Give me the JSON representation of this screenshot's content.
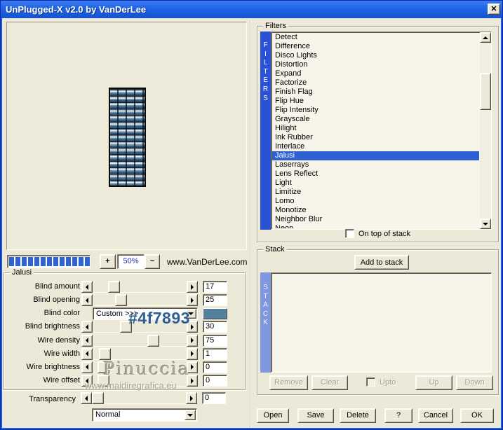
{
  "window": {
    "title": "UnPlugged-X v2.0 by VanDerLee",
    "close_label": "✕"
  },
  "preview": {
    "zoom_in": "+",
    "zoom_level": "50%",
    "zoom_out": "−",
    "website": "www.VanDerLee.com",
    "progress_segments": 13
  },
  "watermarks": {
    "color_code": "#4f7893",
    "signature": "Pinuccia",
    "site": "www.maidiregrafica.eu"
  },
  "jalusi": {
    "label": "Jalusi",
    "rows": [
      {
        "type": "slider",
        "label": "Blind amount",
        "value": "17",
        "pos": 19
      },
      {
        "type": "slider",
        "label": "Blind opening",
        "value": "25",
        "pos": 27
      },
      {
        "type": "color",
        "label": "Blind color",
        "value": "Custom >>>",
        "swatch": "#54809e"
      },
      {
        "type": "slider",
        "label": "Blind brightness",
        "value": "30",
        "pos": 33
      },
      {
        "type": "slider",
        "label": "Wire density",
        "value": "75",
        "pos": 67
      },
      {
        "type": "slider",
        "label": "Wire width",
        "value": "1",
        "pos": 8
      },
      {
        "type": "slider",
        "label": "Wire brightness",
        "value": "0",
        "pos": 6
      },
      {
        "type": "slider",
        "label": "Wire offset",
        "value": "0",
        "pos": 6
      }
    ],
    "transparency": {
      "label": "Transparency",
      "value": "0",
      "pos": 0
    },
    "blend_mode": "Normal"
  },
  "filters": {
    "label": "Filters",
    "sidebar": "FILTERS",
    "items": [
      "Detect",
      "Difference",
      "Disco Lights",
      "Distortion",
      "Expand",
      "Factorize",
      "Finish Flag",
      "Flip Hue",
      "Flip Intensity",
      "Grayscale",
      "Hilight",
      "Ink Rubber",
      "Interlace",
      "Jalusi",
      "Laserrays",
      "Lens Reflect",
      "Light",
      "Limitize",
      "Lomo",
      "Monotize",
      "Neighbor Blur",
      "Neon"
    ],
    "selected_item": "Jalusi",
    "on_top_checkbox": "On top of stack"
  },
  "stack": {
    "label": "Stack",
    "add_button": "Add to stack",
    "sidebar": "STACK",
    "remove": "Remove",
    "clear": "Clear",
    "upto": "Upto",
    "up": "Up",
    "down": "Down"
  },
  "footer": {
    "open": "Open",
    "save": "Save",
    "delete": "Delete",
    "help": "?",
    "cancel": "Cancel",
    "ok": "OK"
  },
  "colors": {
    "titlebar": "#1f64e6",
    "selection": "#2e5fd3",
    "filters_bar": "#2a52d6",
    "stack_bar": "#7e97de",
    "progress": "#2e63d4",
    "swatch": "#54809e"
  }
}
